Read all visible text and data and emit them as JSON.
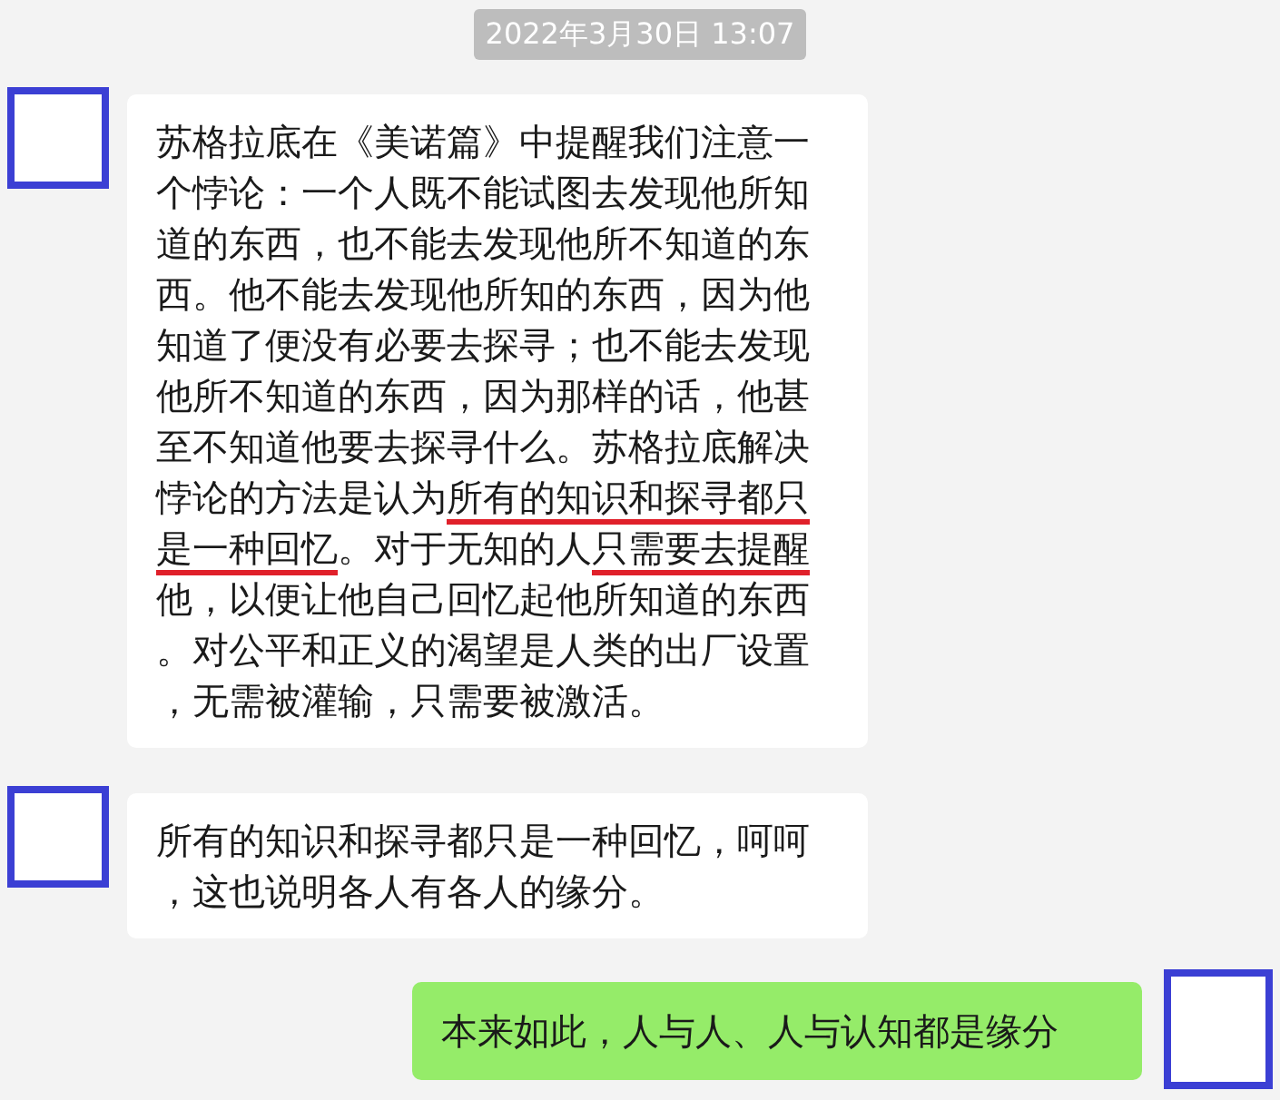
{
  "timestamp": "2022年3月30日 13:07",
  "messages": [
    {
      "kind": "incoming",
      "segments": [
        {
          "text": "苏格拉底在《美诺篇》中提醒我们注意一个悖论：一个人既不能试图去发现他所知道的东西，也不能去发现他所不知道的东西。他不能去发现他所知的东西，因为他知道了便没有必要去探寻；也不能去发现他所不知道的东西，因为那样的话，他甚至不知道他要去探寻什么。苏格拉底解决悖论的方法是认为",
          "underlined": false
        },
        {
          "text": "所有的知识和探寻都只是一种回忆",
          "underlined": true
        },
        {
          "text": "。对于无知的人",
          "underlined": false
        },
        {
          "text": "只需要去提醒",
          "underlined": true
        },
        {
          "text": "他，以便让他自己回忆起他所知道的东西。对公平和正义的渴望是人类的出厂设置，无需被灌输，只需要被激活。",
          "underlined": false
        }
      ]
    },
    {
      "kind": "incoming",
      "segments": [
        {
          "text": "所有的知识和探寻都只是一种回忆，呵呵，这也说明各人有各人的缘分。",
          "underlined": false
        }
      ]
    },
    {
      "kind": "outgoing",
      "segments": [
        {
          "text": "本来如此，人与人、人与认知都是缘分",
          "underlined": false
        }
      ]
    }
  ]
}
